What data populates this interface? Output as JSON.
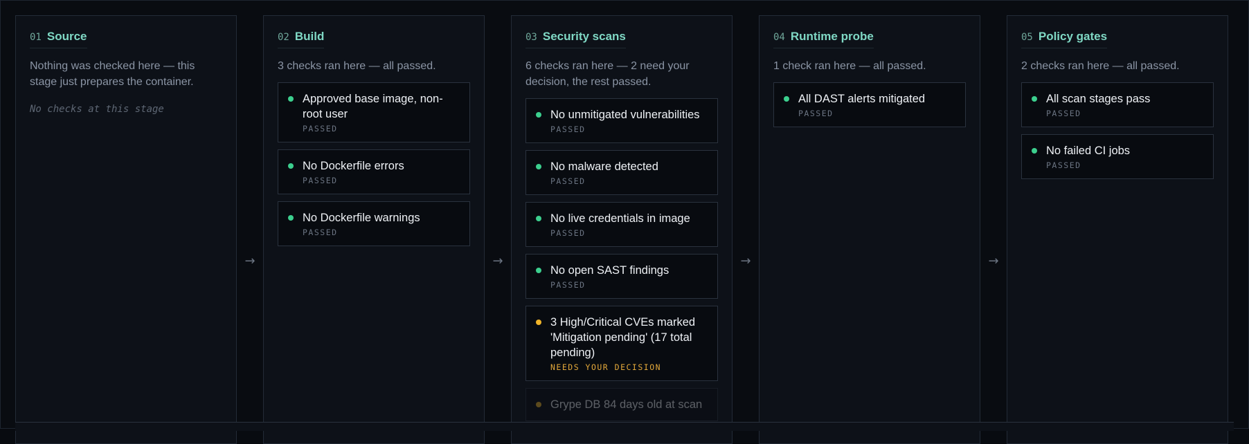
{
  "colors": {
    "passed": "#3ccf8e",
    "pending": "#f0b429"
  },
  "stages": [
    {
      "num": "01",
      "name": "Source",
      "summary": "Nothing was checked here — this stage just prepares the container.",
      "empty": "No checks at this stage",
      "checks": []
    },
    {
      "num": "02",
      "name": "Build",
      "summary": "3 checks ran here — all passed.",
      "checks": [
        {
          "title": "Approved base image, non-root user",
          "status": "PASSED"
        },
        {
          "title": "No Dockerfile errors",
          "status": "PASSED"
        },
        {
          "title": "No Dockerfile warnings",
          "status": "PASSED"
        }
      ]
    },
    {
      "num": "03",
      "name": "Security scans",
      "summary": "6 checks ran here — 2 need your decision, the rest passed.",
      "checks": [
        {
          "title": "No unmitigated vulnerabilities",
          "status": "PASSED"
        },
        {
          "title": "No malware detected",
          "status": "PASSED"
        },
        {
          "title": "No live credentials in image",
          "status": "PASSED"
        },
        {
          "title": "No open SAST findings",
          "status": "PASSED"
        },
        {
          "title": "3 High/Critical CVEs marked 'Mitigation pending' (17 total pending)",
          "status": "NEEDS YOUR DECISION"
        },
        {
          "title": "Grype DB 84 days old at scan",
          "status": ""
        }
      ]
    },
    {
      "num": "04",
      "name": "Runtime probe",
      "summary": "1 check ran here — all passed.",
      "checks": [
        {
          "title": "All DAST alerts mitigated",
          "status": "PASSED"
        }
      ]
    },
    {
      "num": "05",
      "name": "Policy gates",
      "summary": "2 checks ran here — all passed.",
      "checks": [
        {
          "title": "All scan stages pass",
          "status": "PASSED"
        },
        {
          "title": "No failed CI jobs",
          "status": "PASSED"
        }
      ]
    }
  ],
  "arrow_glyph": "→"
}
